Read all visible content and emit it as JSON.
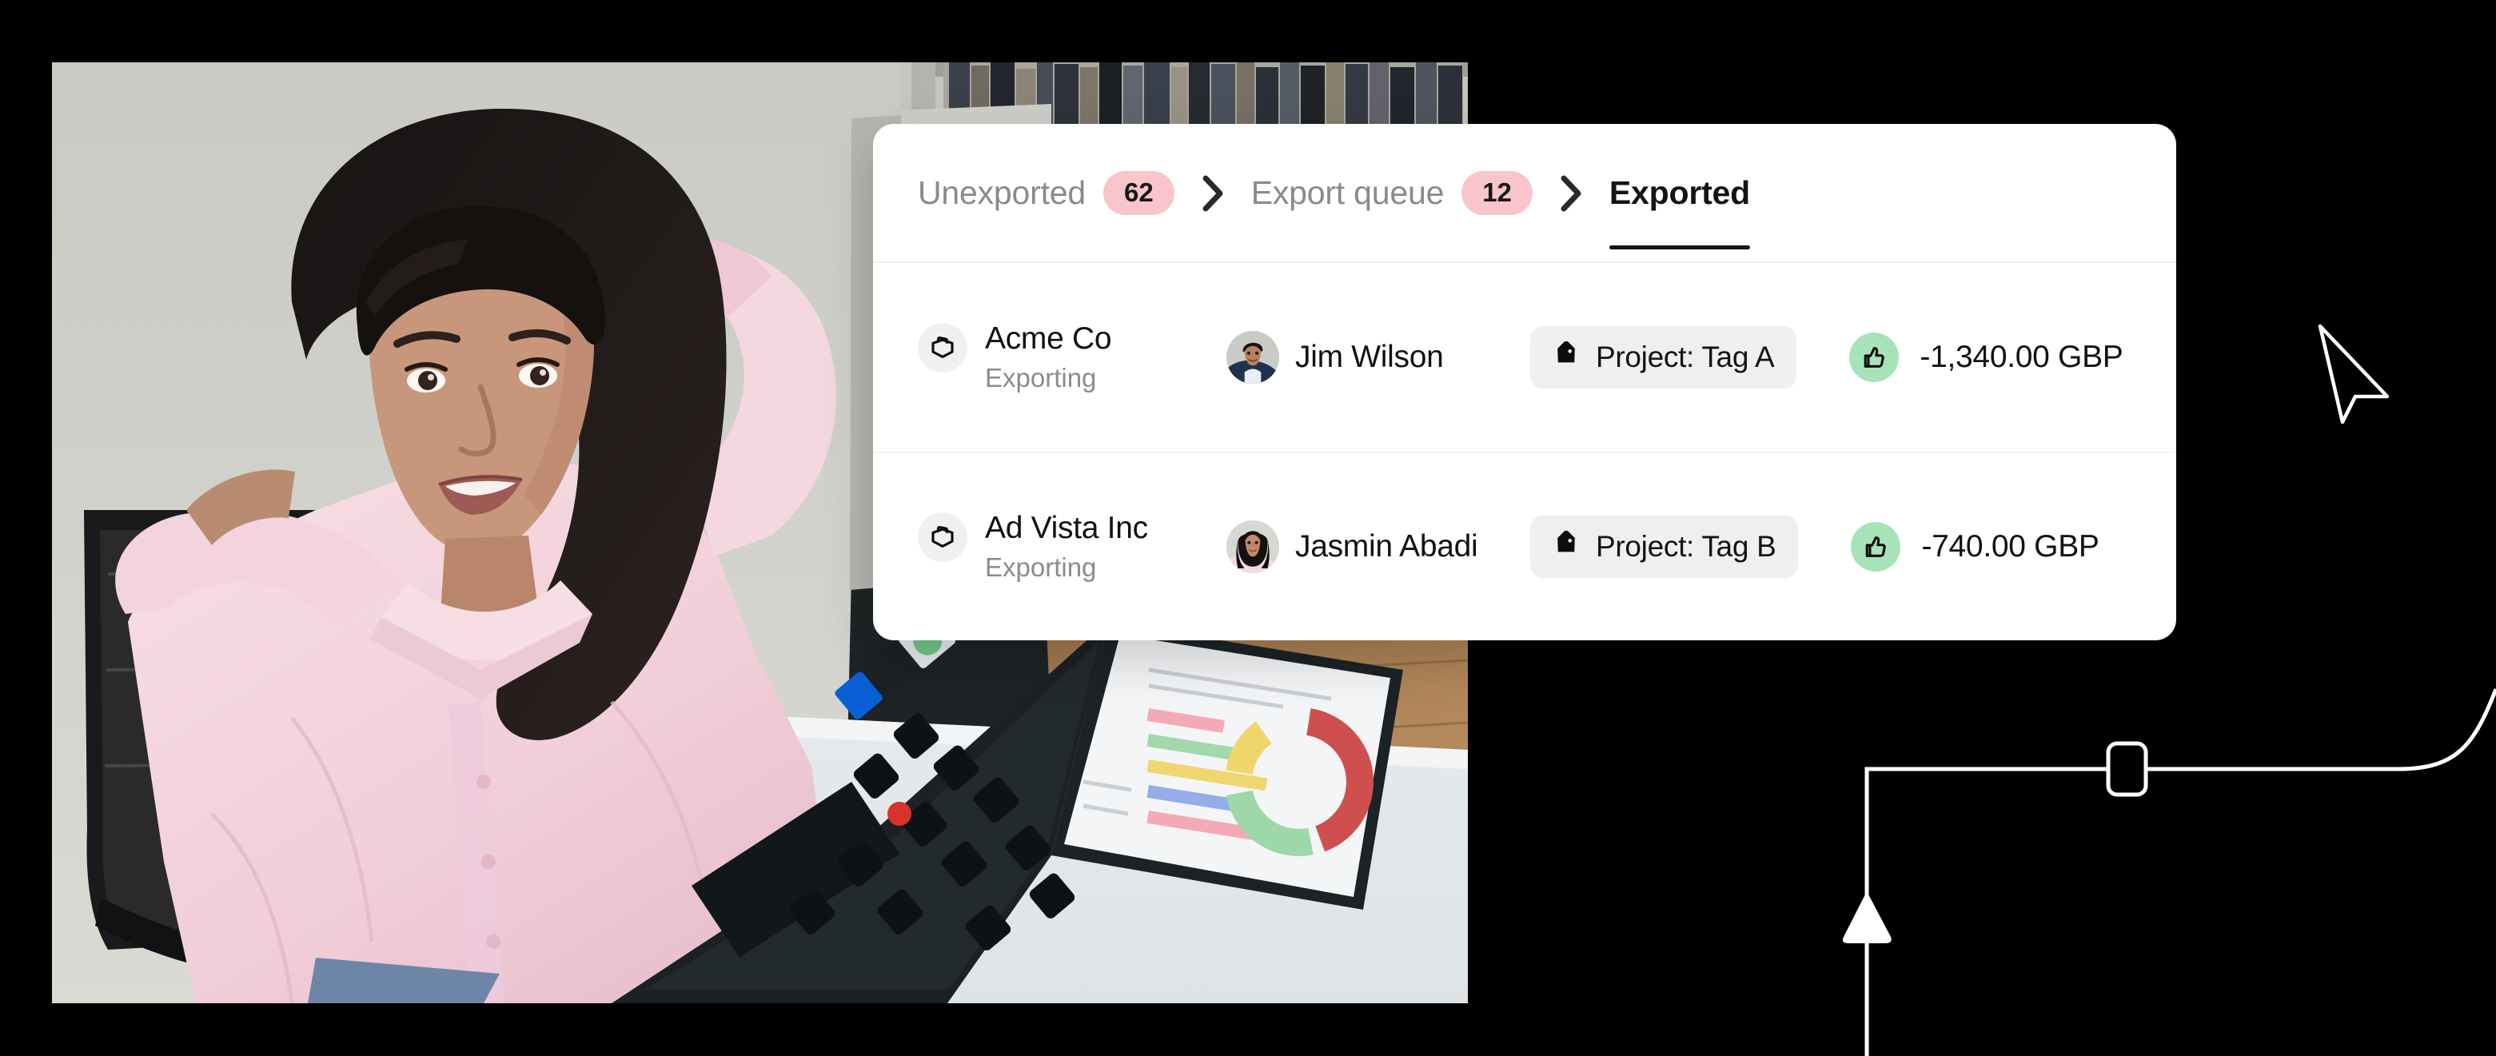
{
  "theme": {
    "page_background": "#000000",
    "card_background": "#FFFFFF",
    "badge_pink": "#FAC4CB",
    "thumb_green": "#A7E3B8",
    "tag_grey": "#EFEFEF",
    "text_primary": "#121212",
    "text_muted": "#8A8A8A",
    "divider": "#F2F2F2",
    "accent_underline": "#141414"
  },
  "card": {
    "tabs": [
      {
        "label": "Unexported",
        "badge": "62",
        "active": false,
        "has_badge": true
      },
      {
        "label": "Export queue",
        "badge": "12",
        "active": false,
        "has_badge": true
      },
      {
        "label": "Exported",
        "badge": "",
        "active": true,
        "has_badge": false
      }
    ],
    "separator_icon": "chevron-right-icon",
    "rows": [
      {
        "company": "Acme Co",
        "company_icon": "briefcase-icon",
        "status": "Exporting",
        "person": "Jim Wilson",
        "avatar_icon": "avatar-jim-wilson",
        "tag_icon": "tag-icon",
        "tag": "Project: Tag A",
        "approval_icon": "thumbs-up-icon",
        "amount": "-1,340.00 GBP"
      },
      {
        "company": "Ad Vista Inc",
        "company_icon": "briefcase-icon",
        "status": "Exporting",
        "person": "Jasmin Abadi",
        "avatar_icon": "avatar-jasmin-abadi",
        "tag_icon": "tag-icon",
        "tag": "Project: Tag B",
        "approval_icon": "thumbs-up-icon",
        "amount": "-740.00 GBP"
      }
    ]
  },
  "photo": {
    "alt": "Woman in pink shirt leaning back at a desk with a laptop and bookshelf"
  },
  "decoration": {
    "cursor_icon": "mouse-pointer-icon",
    "node_icon": "rounded-square-node",
    "marker_icon": "triangle-marker",
    "connector_icon": "elbow-connector-line"
  }
}
